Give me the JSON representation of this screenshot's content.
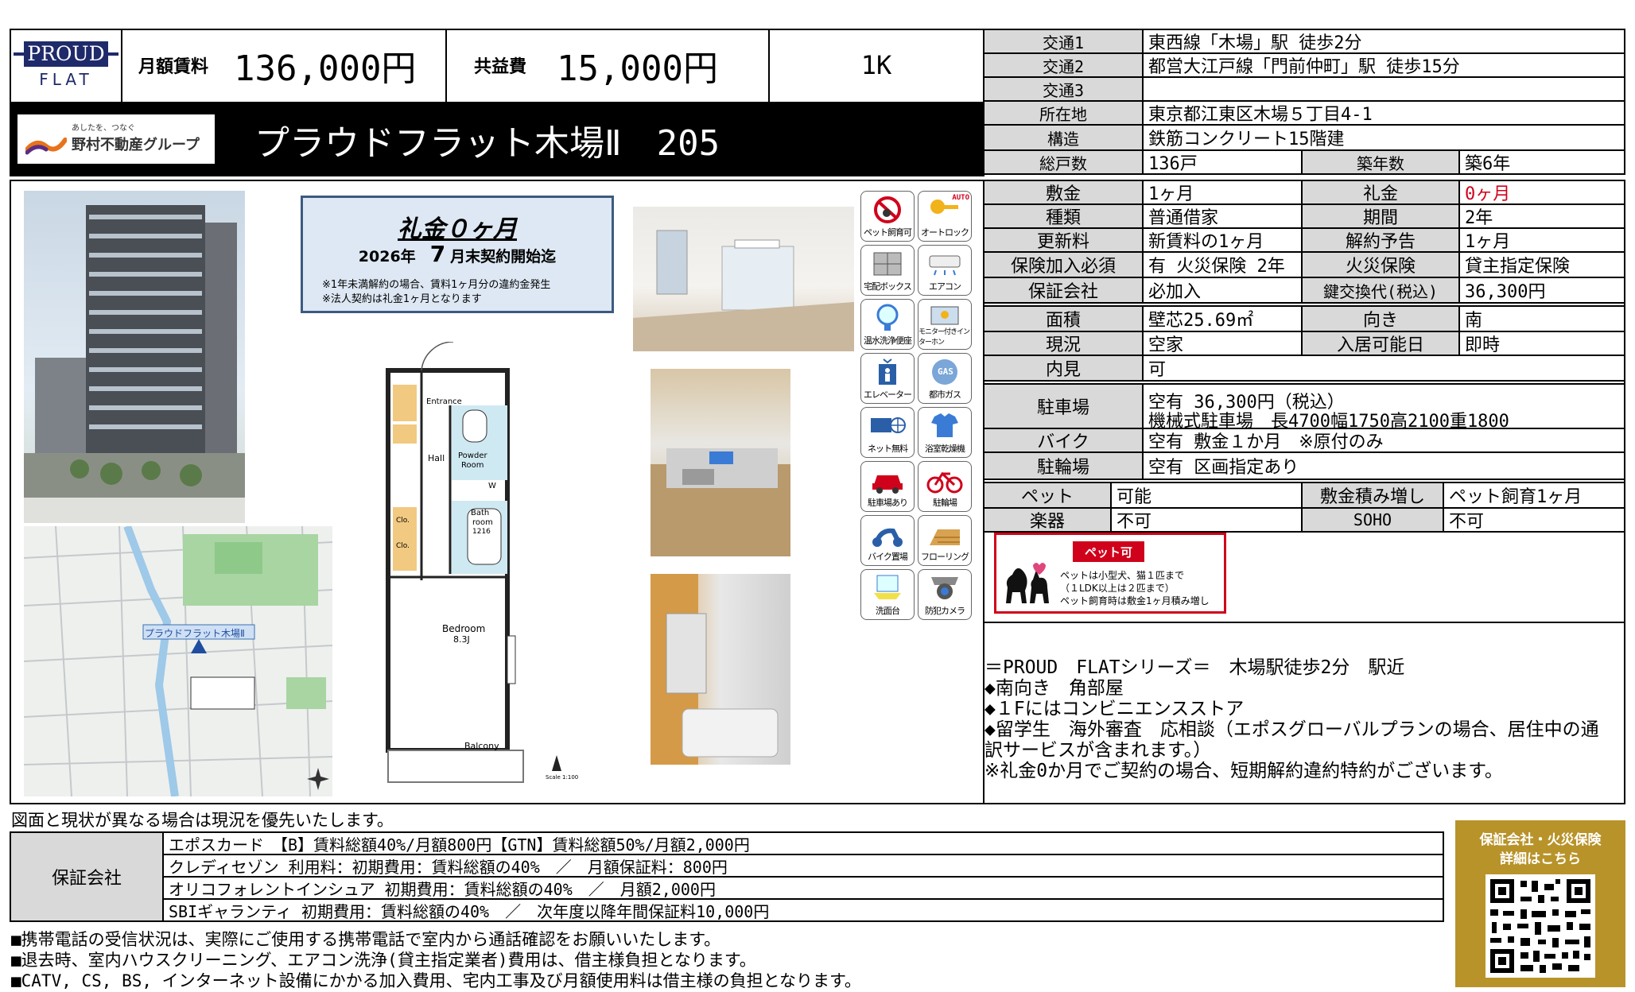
{
  "header": {
    "brand_top": "PROUD",
    "brand_bottom": "FLAT",
    "rent_label": "月額賃料",
    "rent_value": "136,000円",
    "fee_label": "共益費",
    "fee_value": "15,000円",
    "layout": "1K",
    "group_tagline": "あしたを、つなぐ",
    "group_name": "野村不動産グループ",
    "property_name": "プラウドフラット木場Ⅱ　205"
  },
  "info_top": [
    {
      "label": "交通1",
      "value": "東西線「木場」駅 徒歩2分"
    },
    {
      "label": "交通2",
      "value": "都営大江戸線「門前仲町」駅 徒歩15分"
    },
    {
      "label": "交通3",
      "value": ""
    },
    {
      "label": "所在地",
      "value": "東京都江東区木場５丁目4-1"
    },
    {
      "label": "構造",
      "value": "鉄筋コンクリート15階建"
    }
  ],
  "units_row": {
    "label": "総戸数",
    "value": "136戸",
    "label2": "築年数",
    "value2": "築6年"
  },
  "terms": [
    {
      "label": "敷金",
      "value": "1ヶ月",
      "label2": "礼金",
      "value2": "0ヶ月"
    },
    {
      "label": "種類",
      "value": "普通借家",
      "label2": "期間",
      "value2": "2年"
    },
    {
      "label": "更新料",
      "value": "新賃料の1ヶ月",
      "label2": "解約予告",
      "value2": "1ヶ月"
    },
    {
      "label": "保険加入必須",
      "value": "有 火災保険 2年",
      "label2": "火災保険",
      "value2": "貸主指定保険"
    },
    {
      "label": "保証会社",
      "value": "必加入",
      "label2": "鍵交換代(税込)",
      "value2": "36,300円"
    }
  ],
  "room": [
    {
      "label": "面積",
      "value": "壁芯25.69㎡",
      "label2": "向き",
      "value2": "南"
    },
    {
      "label": "現況",
      "value": "空家",
      "label2": "入居可能日",
      "value2": "即時"
    },
    {
      "label": "内見",
      "value": "可"
    }
  ],
  "parking": {
    "label": "駐車場",
    "line1": "空有 36,300円（税込）",
    "line2": "機械式駐車場　長4700幅1750高2100重1800"
  },
  "bike": {
    "label": "バイク",
    "value": "空有 敷金１か月　※原付のみ"
  },
  "bicycle": {
    "label": "駐輪場",
    "value": "空有 区画指定あり"
  },
  "pet_row": {
    "label": "ペット",
    "value": "可能",
    "label2": "敷金積み増し",
    "value2": "ペット飼育1ヶ月"
  },
  "music_row": {
    "label": "楽器",
    "value": "不可",
    "label2": "SOHO",
    "value2": "不可"
  },
  "pet_badge": {
    "title": "ペット可",
    "line1": "ペットは小型犬、猫１匹まで",
    "line2": "（１LDK以上は２匹まで）",
    "line3": "ペット飼育時は敷金1ヶ月積み増し"
  },
  "campaign": {
    "title": "礼金０ヶ月",
    "year": "2026年",
    "month": "7",
    "date_suffix": "月末契約開始迄",
    "note1": "※1年未満解約の場合、賃料1ヶ月分の違約金発生",
    "note2": "※法人契約は礼金1ヶ月となります"
  },
  "floor_plan": {
    "entrance": "Entrance",
    "hall": "Hall",
    "powder": "Powder",
    "powder2": "Room",
    "bath": "Bath",
    "bath2": "room",
    "bath3": "1216",
    "bedroom": "Bedroom",
    "bedroom_size": "8.3J",
    "balcony": "Balcony",
    "clo": "Clo.",
    "scale": "Scale 1:100",
    "wm": "W"
  },
  "map": {
    "label": "プラウドフラット木場Ⅱ"
  },
  "icons": [
    {
      "name": "pet-icon",
      "label": "ペット飼育可"
    },
    {
      "name": "auto-lock-icon",
      "label": "オートロック",
      "badge": "AUTO"
    },
    {
      "name": "delivery-box-icon",
      "label": "宅配ボックス"
    },
    {
      "name": "air-conditioner-icon",
      "label": "エアコン"
    },
    {
      "name": "bidet-icon",
      "label": "温水洗浄便座"
    },
    {
      "name": "monitor-intercom-icon",
      "label": "モニター付きインターホン"
    },
    {
      "name": "elevator-icon",
      "label": "エレベーター"
    },
    {
      "name": "city-gas-icon",
      "label": "都市ガス",
      "badge": "GAS"
    },
    {
      "name": "free-internet-icon",
      "label": "ネット無料"
    },
    {
      "name": "bathroom-dryer-icon",
      "label": "浴室乾燥機"
    },
    {
      "name": "car-parking-icon",
      "label": "駐車場あり"
    },
    {
      "name": "bicycle-parking-icon",
      "label": "駐輪場"
    },
    {
      "name": "bike-parking-icon",
      "label": "バイク置場"
    },
    {
      "name": "flooring-icon",
      "label": "フローリング"
    },
    {
      "name": "washbasin-icon",
      "label": "洗面台"
    },
    {
      "name": "security-camera-icon",
      "label": "防犯カメラ"
    }
  ],
  "remarks": [
    "＝PROUD　FLATシリーズ＝　木場駅徒歩2分　駅近",
    "◆南向き　角部屋",
    "◆１Fにはコンビニエンスストア",
    "◆留学生　海外審査　応相談（エポスグローバルプランの場合、居住中の通",
    "訳サービスが含まれます。）",
    "※礼金0か月でご契約の場合、短期解約違約特約がございます。"
  ],
  "disclaimer": "図面と現状が異なる場合は現況を優先いたします。",
  "guarantee": {
    "label": "保証会社",
    "lines": [
      "エポスカード　【B】賃料総額40%/月額800円【GTN】賃料総額50%/月額2,000円",
      "クレディセゾン 利用料：初期費用：賃料総額の40%　／　月額保証料：800円",
      "オリコフォレントインシュア 初期費用：賃料総額の40%　／　月額2,000円",
      "SBIギャランティ 初期費用：賃料総額の40%　／　次年度以降年間保証料10,000円"
    ]
  },
  "qr_box": {
    "line1": "保証会社・火災保険",
    "line2": "詳細はこちら"
  },
  "notes": [
    "■携帯電話の受信状況は、実際にご使用する携帯電話で室内から通話確認をお願いいたします。",
    "■退去時、室内ハウスクリーニング、エアコン洗浄(貸主指定業者)費用は、借主様負担となります。",
    "■CATV, CS, BS, インターネット設備にかかる加入費用、宅内工事及び月額使用料は借主様の負担となります。"
  ],
  "colors": {
    "label_bg": "#d9d9d9",
    "brand_navy": "#1f2a6b",
    "campaign_bg": "#dde8f4",
    "campaign_border": "#3d5a80",
    "pet_red": "#d0021b",
    "qr_gold": "#b8932a"
  }
}
